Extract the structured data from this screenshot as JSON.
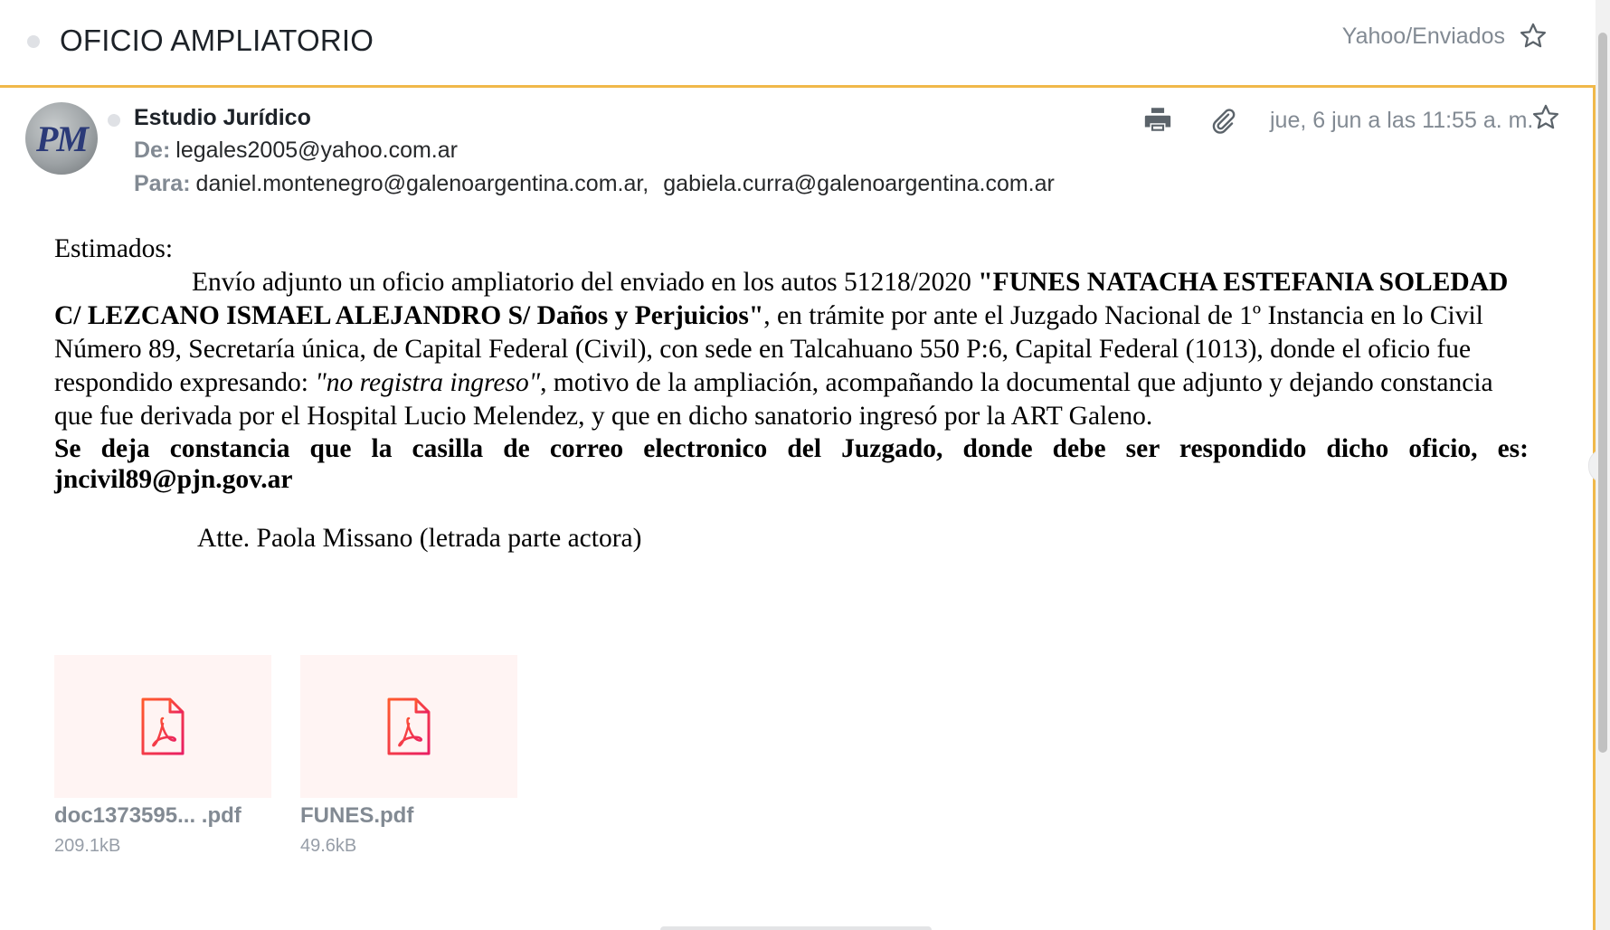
{
  "header": {
    "subject": "OFICIO AMPLIATORIO",
    "folder": "Yahoo/Enviados"
  },
  "message": {
    "avatar_initials": "PM",
    "sender_name": "Estudio Jurídico",
    "from_label": "De:",
    "from_address": "legales2005@yahoo.com.ar",
    "to_label": "Para:",
    "to_addresses": [
      "daniel.montenegro@galenoargentina.com.ar,",
      "gabiela.curra@galenoargentina.com.ar"
    ],
    "date": "jue, 6 jun a las 11:55 a. m.",
    "toolbar_icons": [
      "print-icon",
      "paperclip-icon",
      "star-icon"
    ]
  },
  "body": {
    "greeting": "Estimados:",
    "p1_a": "Envío adjunto un oficio ampliatorio del enviado en los autos 51218/2020 ",
    "p1_case": "\"FUNES NATACHA ESTEFANIA SOLEDAD C/ LEZCANO ISMAEL ALEJANDRO S/ Daños y Perjuicios\"",
    "p1_b": ", en trámite por ante el Juzgado Nacional de 1º Instancia en lo Civil Número 89, Secretaría única, de Capital Federal (Civil), con sede en Talcahuano 550 P:6, Capital Federal (1013), donde el oficio fue respondido expresando: ",
    "p1_quote": "\"no registra ingreso\"",
    "p1_c": ", motivo de la ampliación, acompañando la documental que adjunto y dejando constancia que fue derivada por el Hospital Lucio Melendez, y que en dicho sanatorio ingresó por la ART Galeno.",
    "notice": "Se deja constancia que la casilla de correo electronico del Juzgado, donde debe ser respondido dicho oficio, es: jncivil89@pjn.gov.ar",
    "signature": "Atte. Paola Missano (letrada parte actora)"
  },
  "attachments": [
    {
      "name": "doc1373595... .pdf",
      "size": "209.1kB",
      "icon": "pdf-icon"
    },
    {
      "name": "FUNES.pdf",
      "size": "49.6kB",
      "icon": "pdf-icon"
    }
  ],
  "colors": {
    "accent": "#f0b84a",
    "muted_text": "#828a93",
    "pdf_thumb_bg": "#fff4f3",
    "pdf_icon_gradient": [
      "#ff5a2c",
      "#e91e63"
    ]
  }
}
